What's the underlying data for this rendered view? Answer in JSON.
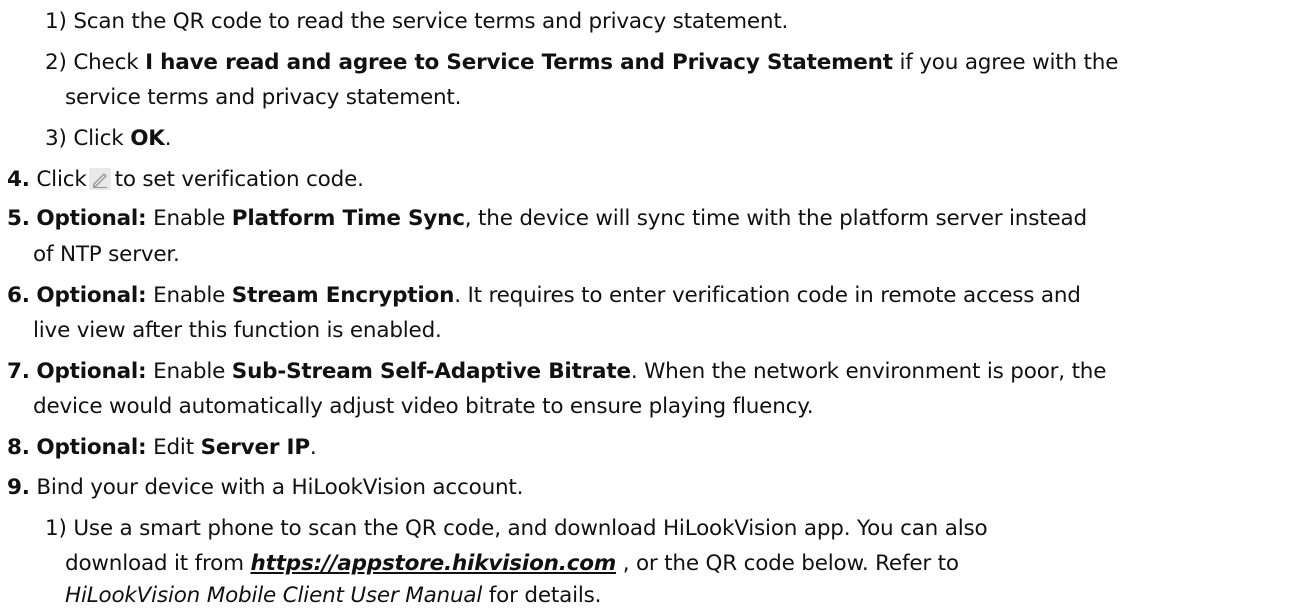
{
  "substeps_a": [
    {
      "num": "1)",
      "text": "Scan the QR code to read the service terms and privacy statement."
    },
    {
      "num": "2)",
      "pre": "Check",
      "bold": "I have read and agree to Service Terms and Privacy Statement",
      "post": "if you agree with the",
      "cont": "service terms and privacy statement."
    },
    {
      "num": "3)",
      "pre": "Click",
      "bold": "OK",
      "post": "."
    }
  ],
  "steps": [
    {
      "num": "4.",
      "pre": "Click",
      "icon": "edit-pencil-icon",
      "post": "to set verification code."
    },
    {
      "num": "5.",
      "label": "Optional:",
      "pre": "Enable",
      "bold": "Platform Time Sync",
      "post": ", the device will sync time with the platform server instead",
      "cont": "of NTP server."
    },
    {
      "num": "6.",
      "label": "Optional:",
      "pre": "Enable",
      "bold": "Stream Encryption",
      "post": ". It requires to enter verification code in remote access and",
      "cont": "live view after this function is enabled."
    },
    {
      "num": "7.",
      "label": "Optional:",
      "pre": "Enable",
      "bold": "Sub-Stream Self-Adaptive Bitrate",
      "post": ". When the network environment is poor, the",
      "cont": "device would automatically adjust video bitrate to ensure playing fluency."
    },
    {
      "num": "8.",
      "label": "Optional:",
      "pre": "Edit",
      "bold": "Server IP",
      "post": "."
    },
    {
      "num": "9.",
      "text": "Bind your device with a HiLookVision account."
    }
  ],
  "substep_b": {
    "num": "1)",
    "line1": "Use a smart phone to scan the QR code, and download HiLookVision app. You can also",
    "line2_pre": "download it from",
    "link": "https://appstore.hikvision.com",
    "line2_post": ", or the QR code below. Refer to",
    "italic": "HiLookVision Mobile Client User Manual",
    "line3_post": "for details."
  }
}
